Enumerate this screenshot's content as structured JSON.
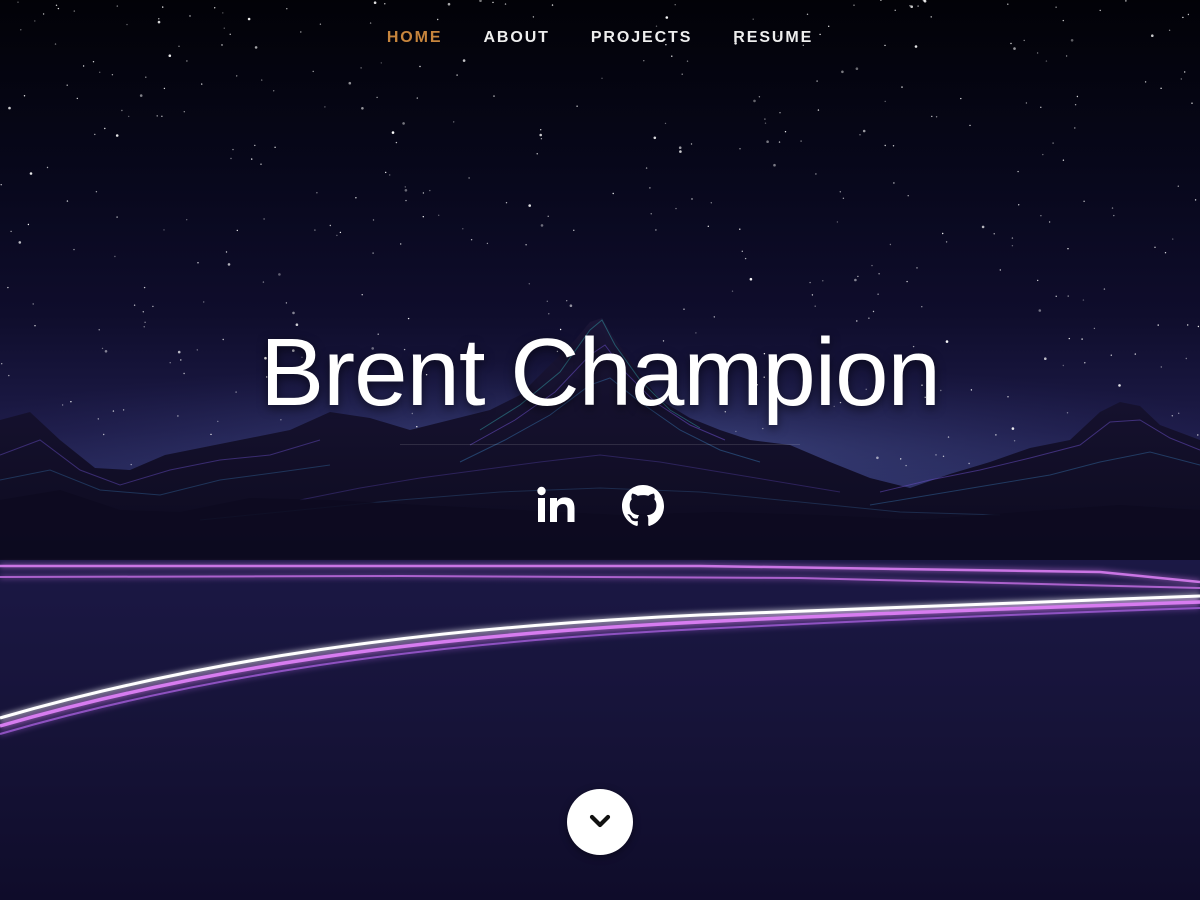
{
  "nav": {
    "items": [
      {
        "label": "HOME",
        "active": true
      },
      {
        "label": "ABOUT",
        "active": false
      },
      {
        "label": "PROJECTS",
        "active": false
      },
      {
        "label": "RESUME",
        "active": false
      }
    ]
  },
  "hero": {
    "name": "Brent Champion"
  },
  "social": {
    "items": [
      {
        "icon": "linkedin-icon"
      },
      {
        "icon": "github-icon"
      }
    ]
  },
  "scroll": {
    "icon": "chevron-down-icon"
  },
  "colors": {
    "nav_active": "#c7853d",
    "nav_text": "#eeeeee",
    "title_text": "#ffffff",
    "light_trail": "#d77cf0"
  }
}
